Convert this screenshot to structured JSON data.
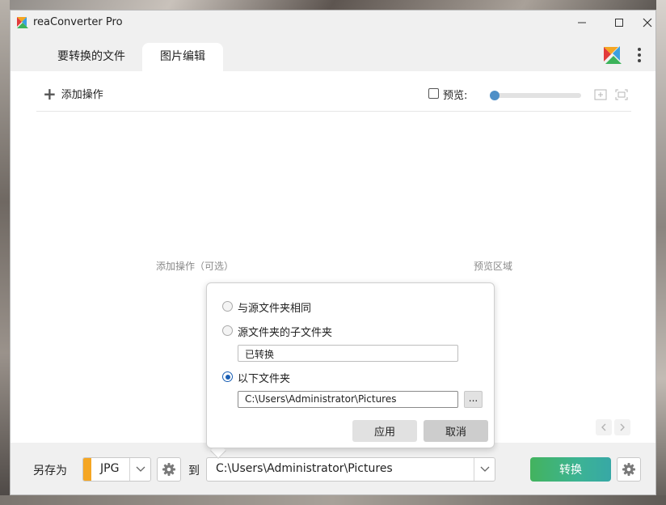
{
  "window": {
    "title": "reaConverter Pro"
  },
  "tabs": [
    {
      "label": "要转换的文件",
      "active": false
    },
    {
      "label": "图片编辑",
      "active": true
    }
  ],
  "toolbar": {
    "add_operation": "添加操作",
    "preview_label": "预览:",
    "preview_checked": false
  },
  "content": {
    "hint_operations": "添加操作（可选）",
    "hint_preview": "预览区域"
  },
  "bottom": {
    "save_as_label": "另存为",
    "format": "JPG",
    "format_accent": "#f5a623",
    "to_label": "到",
    "output_path": "C:\\Users\\Administrator\\Pictures",
    "convert_label": "转换",
    "convert_color": "#43b35e"
  },
  "popup": {
    "options": [
      {
        "label": "与源文件夹相同",
        "checked": false
      },
      {
        "label": "源文件夹的子文件夹",
        "checked": false
      },
      {
        "label": "以下文件夹",
        "checked": true
      }
    ],
    "subfolder_value": "已转换",
    "folder_value": "C:\\Users\\Administrator\\Pictures",
    "browse_label": "...",
    "apply_label": "应用",
    "cancel_label": "取消"
  }
}
